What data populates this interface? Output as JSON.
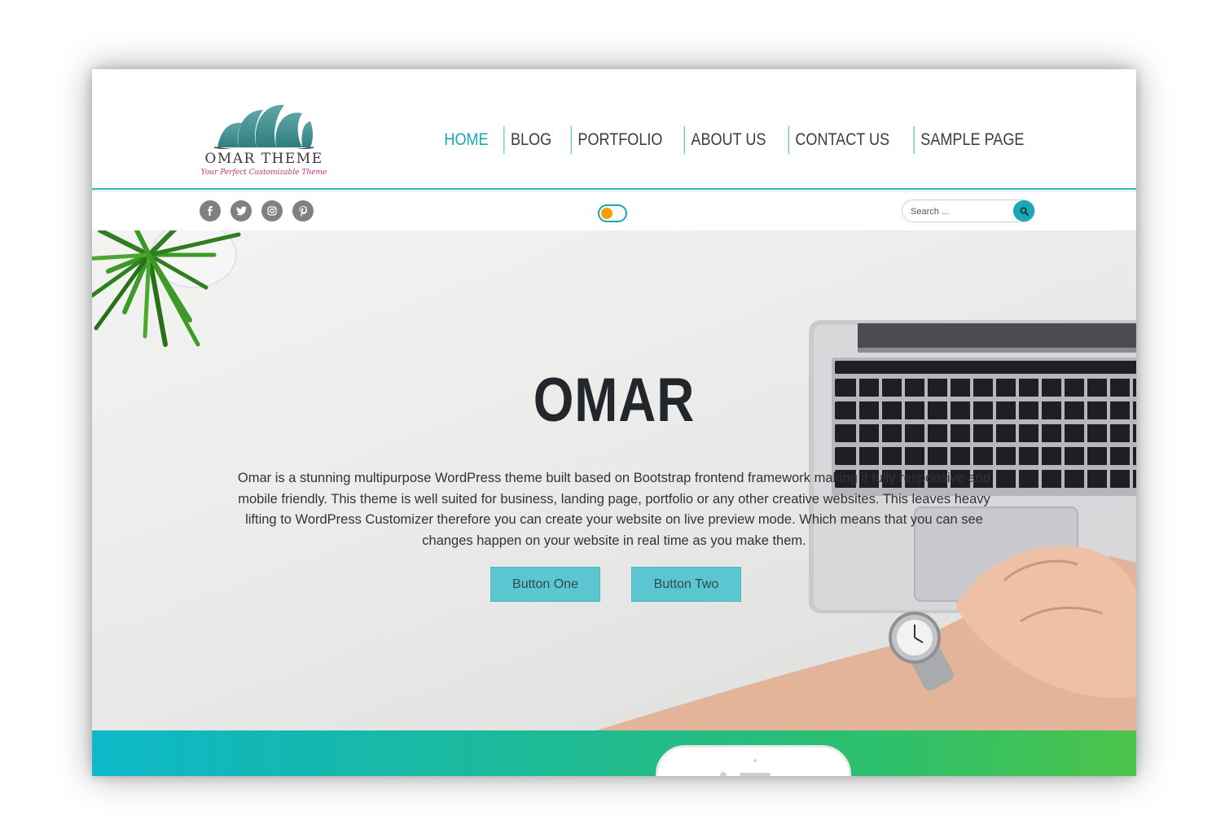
{
  "header": {
    "logo_title": "OMAR THEME",
    "logo_tagline": "Your Perfect Customizable Theme",
    "nav": [
      {
        "label": "HOME",
        "active": true
      },
      {
        "label": "BLOG",
        "active": false
      },
      {
        "label": "PORTFOLIO",
        "active": false
      },
      {
        "label": "ABOUT US",
        "active": false
      },
      {
        "label": "CONTACT US",
        "active": false
      },
      {
        "label": "SAMPLE PAGE",
        "active": false
      }
    ]
  },
  "subbar": {
    "social": [
      {
        "name": "facebook-icon",
        "glyph": "f"
      },
      {
        "name": "twitter-icon",
        "glyph": "t"
      },
      {
        "name": "instagram-icon",
        "glyph": "ig"
      },
      {
        "name": "pinterest-icon",
        "glyph": "p"
      }
    ],
    "search_placeholder": "Search ...",
    "toggle_on": false
  },
  "hero": {
    "title": "OMAR",
    "description": "Omar is a stunning multipurpose WordPress theme built based on Bootstrap frontend framework making it fully responsive and mobile friendly. This theme is well suited for business, landing page, portfolio or any other creative websites. This leaves heavy lifting to WordPress Customizer therefore you can create your website on live preview mode. Which means that you can see changes happen on your website in real time as you make them.",
    "button_one": "Button One",
    "button_two": "Button Two"
  },
  "colors": {
    "accent": "#1aa8b8",
    "button": "#5bc6d0",
    "toggle_knob": "#f4a10b",
    "tagline": "#c2337a",
    "strip_start": "#0db8c8",
    "strip_end": "#4cc44a"
  }
}
